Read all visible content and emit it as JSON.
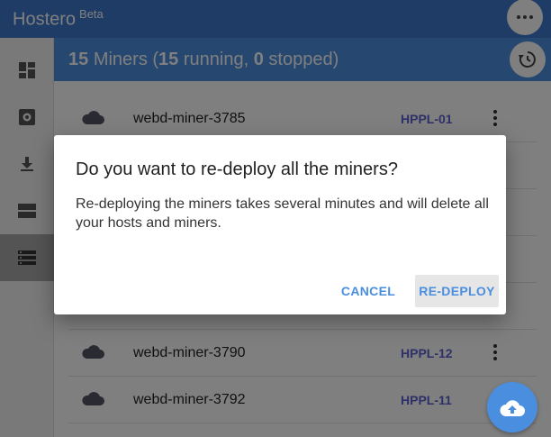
{
  "app": {
    "title": "Hostero",
    "badge": "Beta"
  },
  "sidebar": {
    "items": [
      {
        "icon": "dashboard-icon"
      },
      {
        "icon": "settings-icon"
      },
      {
        "icon": "download-icon"
      },
      {
        "icon": "hosts-icon"
      },
      {
        "icon": "miners-icon",
        "active": true
      }
    ]
  },
  "summary": {
    "count": "15",
    "label": "Miners",
    "running": "15",
    "running_label": "running,",
    "stopped": "0",
    "stopped_label": "stopped"
  },
  "miners": [
    {
      "name": "webd-miner-3785",
      "host": "HPPL-01"
    },
    {
      "name": "webd-miner-3790",
      "host": "HPPL-12"
    },
    {
      "name": "webd-miner-3792",
      "host": "HPPL-11"
    }
  ],
  "dialog": {
    "title": "Do you want to re-deploy all the miners?",
    "body": "Re-deploying the miners takes several minutes and will delete all your hosts and miners.",
    "cancel_label": "CANCEL",
    "confirm_label": "RE-DEPLOY"
  },
  "colors": {
    "appbar": "#3f79cf",
    "accent": "#4a8ee0",
    "host_label": "#5a63cf"
  }
}
